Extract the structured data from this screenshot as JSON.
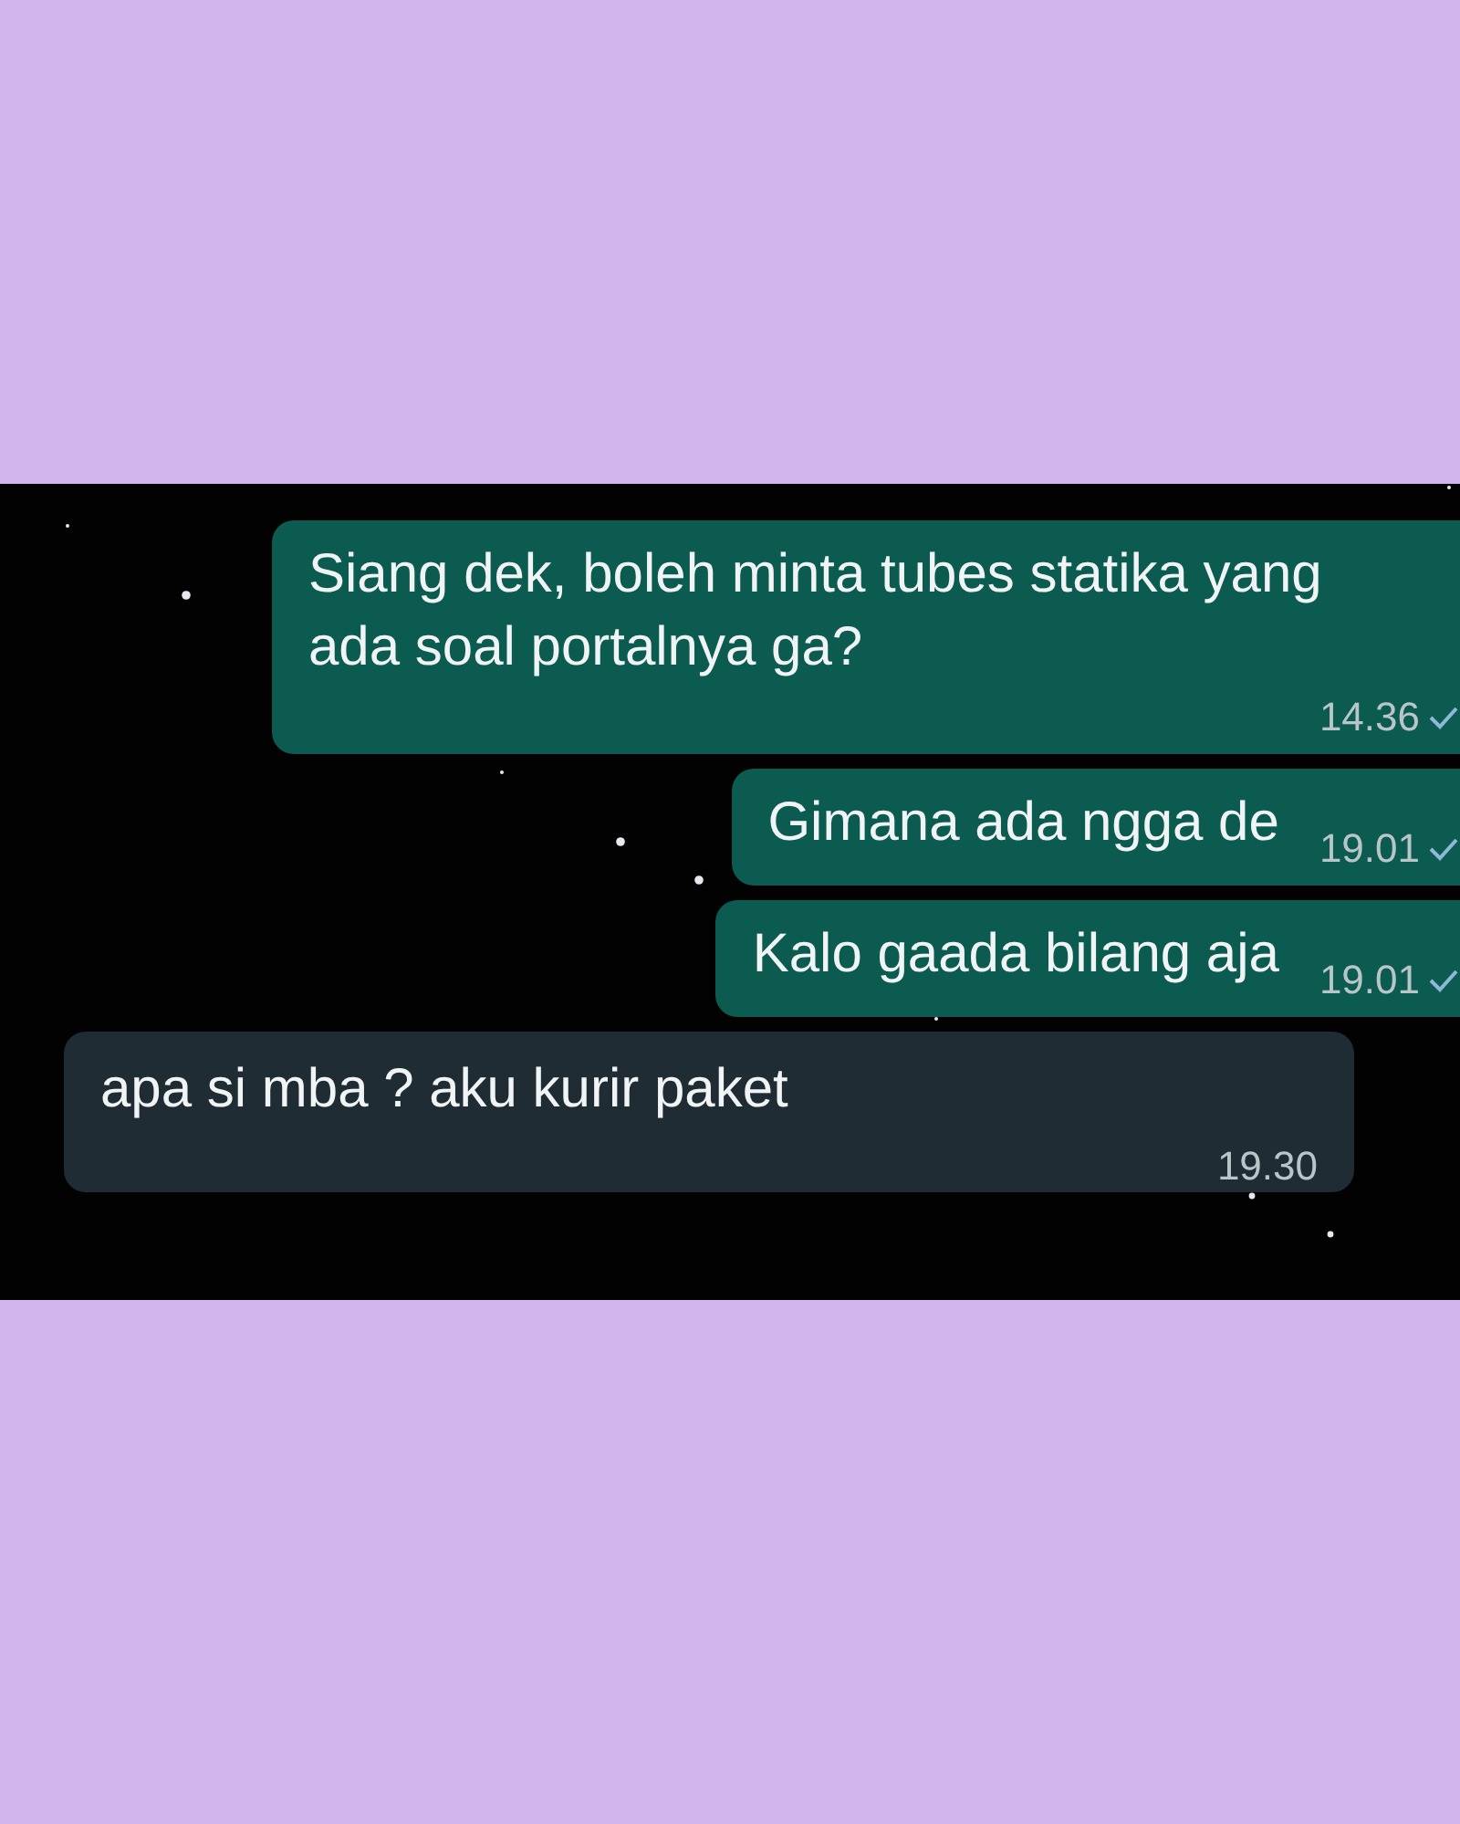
{
  "chat": {
    "messages": [
      {
        "kind": "outgoing",
        "text": "Siang dek, boleh minta tubes statika yang ada soal portalnya ga?",
        "time": "14.36",
        "delivered": false
      },
      {
        "kind": "outgoing",
        "text": "Gimana ada ngga de",
        "time": "19.01",
        "delivered": false
      },
      {
        "kind": "outgoing",
        "text": "Kalo gaada bilang aja",
        "time": "19.01",
        "delivered": false
      },
      {
        "kind": "incoming",
        "text": "apa si mba ? aku kurir paket",
        "time": "19.30"
      }
    ]
  }
}
